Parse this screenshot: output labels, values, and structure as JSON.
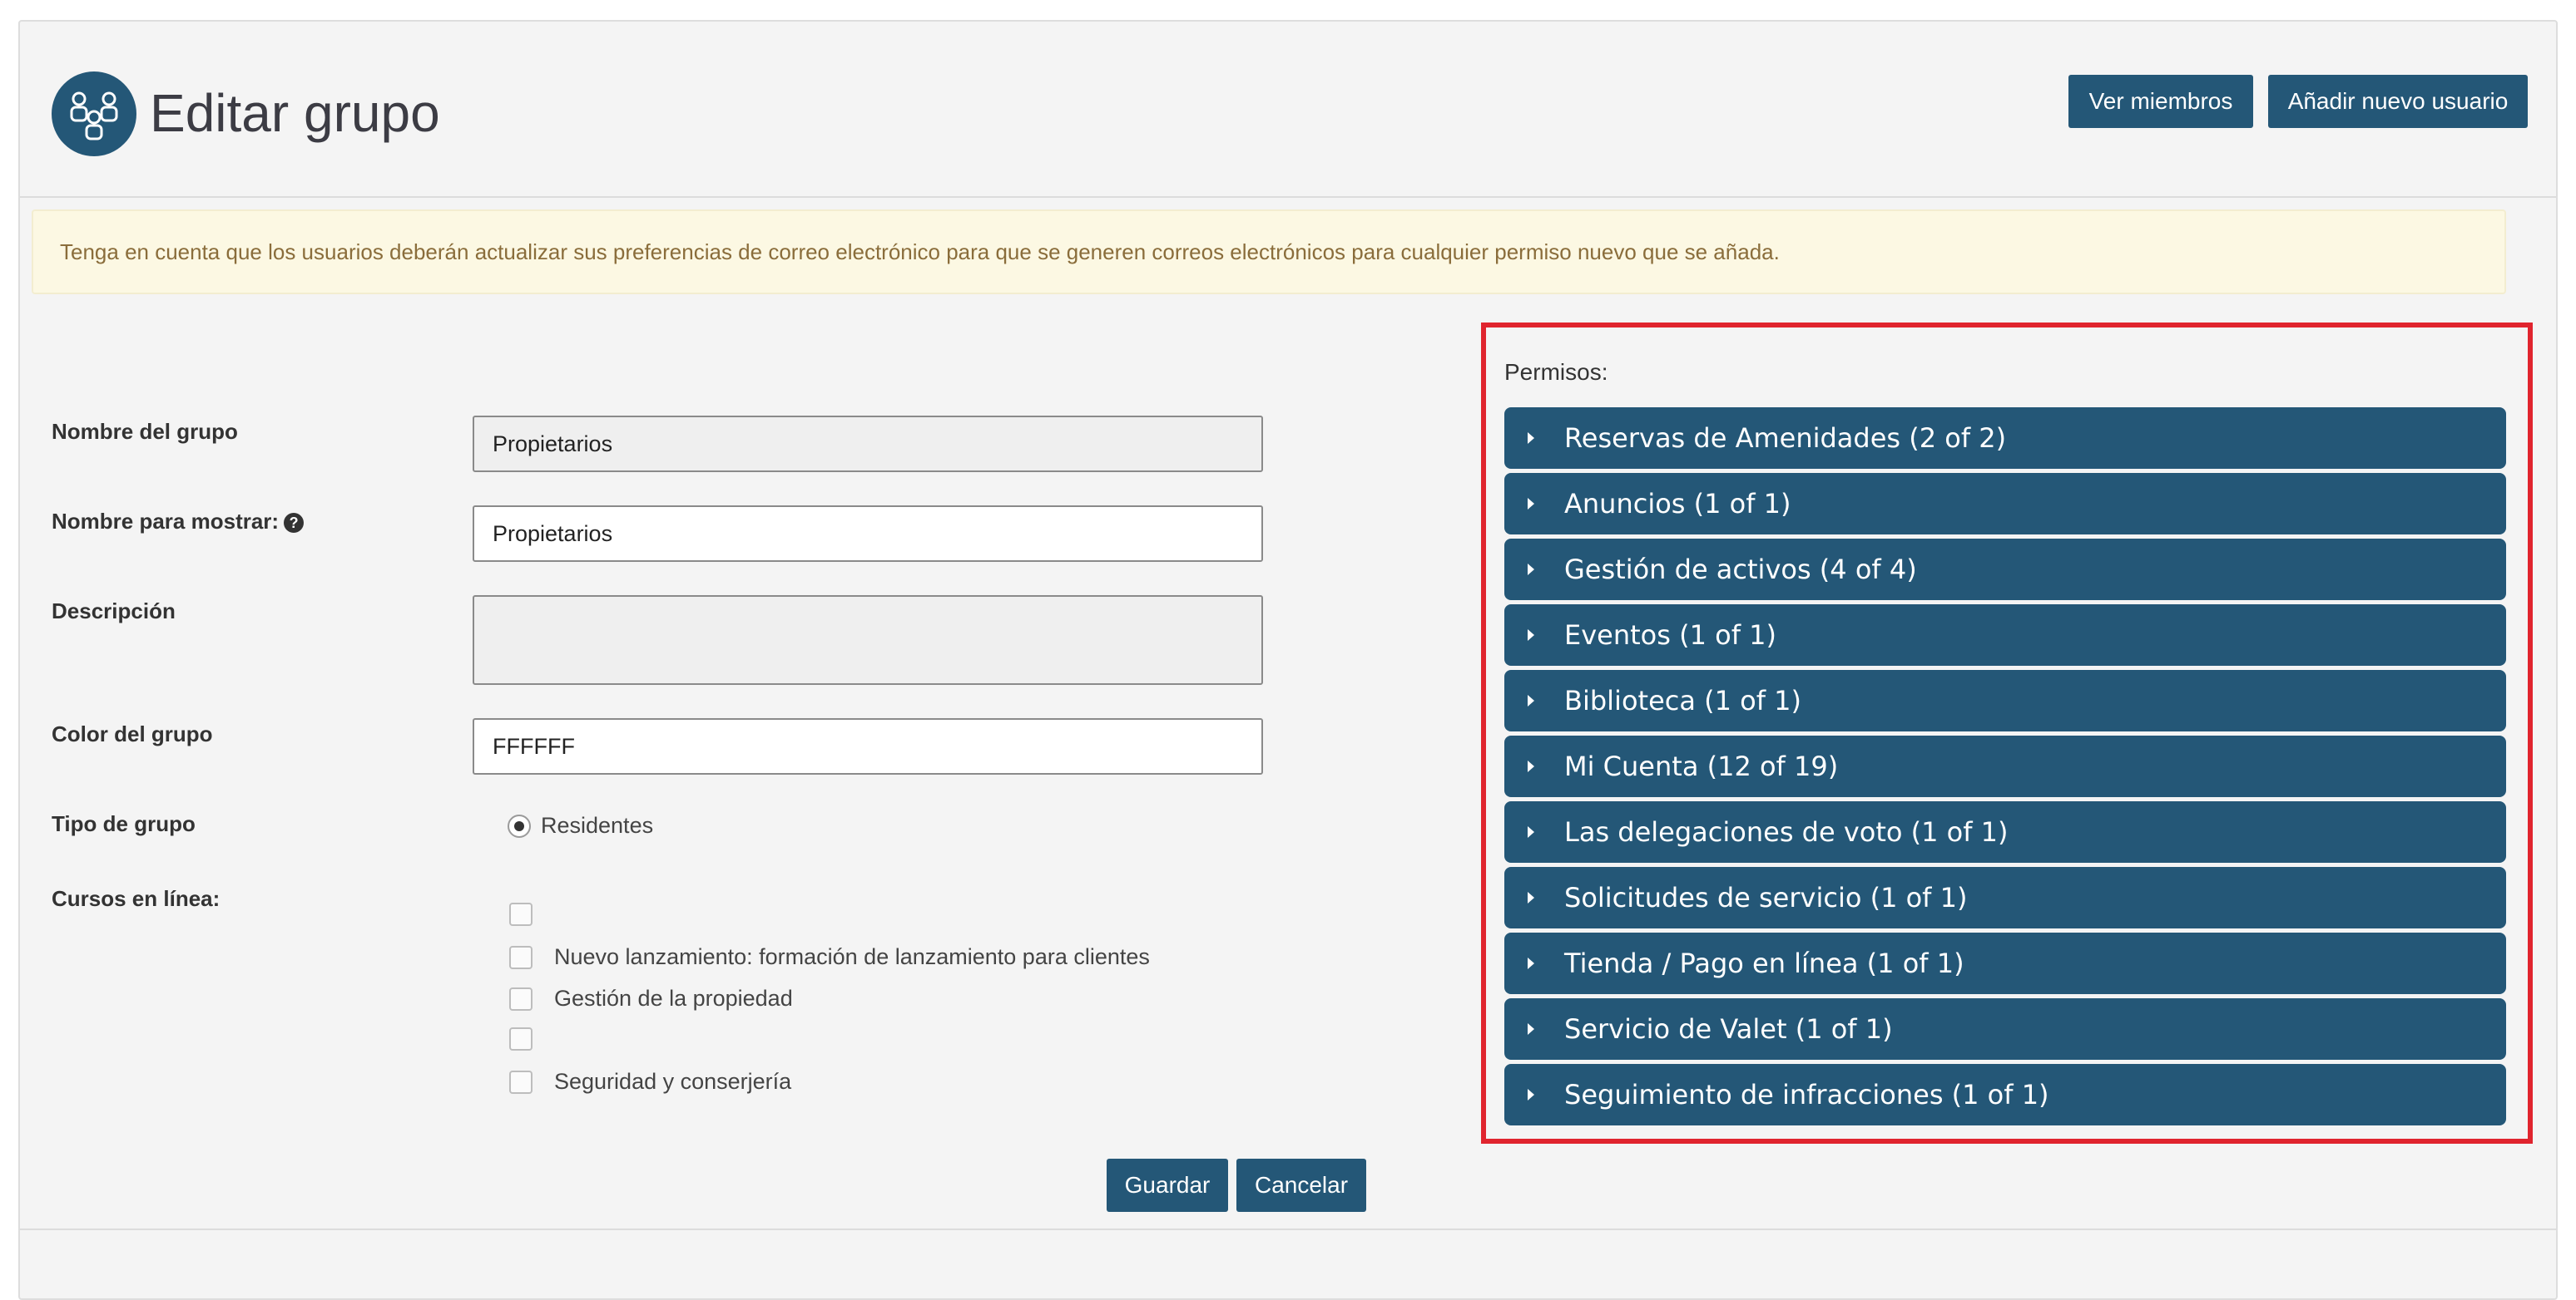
{
  "header": {
    "title": "Editar grupo",
    "view_members_label": "Ver miembros",
    "add_user_label": "Añadir nuevo usuario"
  },
  "alert": {
    "text": "Tenga en cuenta que los usuarios deberán actualizar sus preferencias de correo electrónico para que se generen correos electrónicos para cualquier permiso nuevo que se añada."
  },
  "form": {
    "group_name_label": "Nombre del grupo",
    "group_name_value": "Propietarios",
    "display_name_label": "Nombre para mostrar:",
    "display_name_value": "Propietarios",
    "description_label": "Descripción",
    "description_value": "",
    "color_label": "Color del grupo",
    "color_value": "FFFFFF",
    "group_type_label": "Tipo de grupo",
    "group_type_option": "Residentes",
    "courses_label": "Cursos en línea:",
    "courses": [
      {
        "label": "",
        "checked": false
      },
      {
        "label": "Nuevo lanzamiento: formación de lanzamiento para clientes",
        "checked": false
      },
      {
        "label": "Gestión de la propiedad",
        "checked": false
      },
      {
        "label": "",
        "checked": false
      },
      {
        "label": "Seguridad y conserjería",
        "checked": false
      }
    ]
  },
  "permissions": {
    "title": "Permisos:",
    "items": [
      {
        "label": "Reservas de Amenidades (2 of 2)"
      },
      {
        "label": "Anuncios (1 of 1)"
      },
      {
        "label": "Gestión de activos (4 of 4)"
      },
      {
        "label": "Eventos (1 of 1)"
      },
      {
        "label": "Biblioteca (1 of 1)"
      },
      {
        "label": "Mi Cuenta (12 of 19)"
      },
      {
        "label": "Las delegaciones de voto (1 of 1)"
      },
      {
        "label": "Solicitudes de servicio (1 of 1)"
      },
      {
        "label": "Tienda / Pago en línea (1 of 1)"
      },
      {
        "label": "Servicio de Valet (1 of 1)"
      },
      {
        "label": "Seguimiento de infracciones (1 of 1)"
      }
    ]
  },
  "actions": {
    "save_label": "Guardar",
    "cancel_label": "Cancelar"
  },
  "colors": {
    "primary": "#245777",
    "alert_bg": "#fcf8e3",
    "alert_text": "#8a6d3b",
    "highlight_border": "#e0242e"
  },
  "icons": {
    "header_icon": "group-users-icon",
    "help_icon": "question-circle-icon",
    "accordion_icon": "caret-right-icon"
  }
}
